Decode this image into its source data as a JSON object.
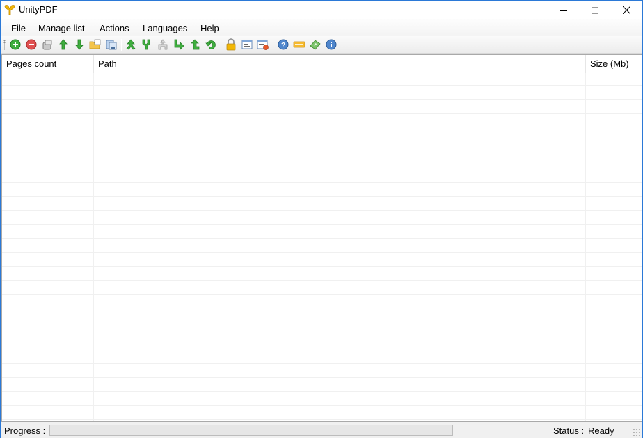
{
  "window": {
    "title": "UnityPDF"
  },
  "menu": [
    "File",
    "Manage list",
    "Actions",
    "Languages",
    "Help"
  ],
  "toolbar": {
    "buttons": [
      "add-icon",
      "remove-icon",
      "clear-list-icon",
      "move-up-icon",
      "move-down-icon",
      "open-folder-icon",
      "save-list-icon",
      "merge-icon",
      "split-icon",
      "extract-icon",
      "rotate-right-icon",
      "rotate-up-icon",
      "undo-icon",
      "lock-icon",
      "properties-icon",
      "settings-icon",
      "help-icon",
      "new-icon",
      "register-icon",
      "info-icon"
    ]
  },
  "list": {
    "columns": [
      "Pages count",
      "Path",
      "Size (Mb)"
    ],
    "rows": []
  },
  "statusbar": {
    "progress_label": "Progress :",
    "progress_value": 0,
    "status_label": "Status :",
    "status_value": "Ready"
  },
  "colors": {
    "accent": "#2b79d7",
    "icon_green": "#2f9a2f",
    "progress_fill": "#06b025"
  }
}
